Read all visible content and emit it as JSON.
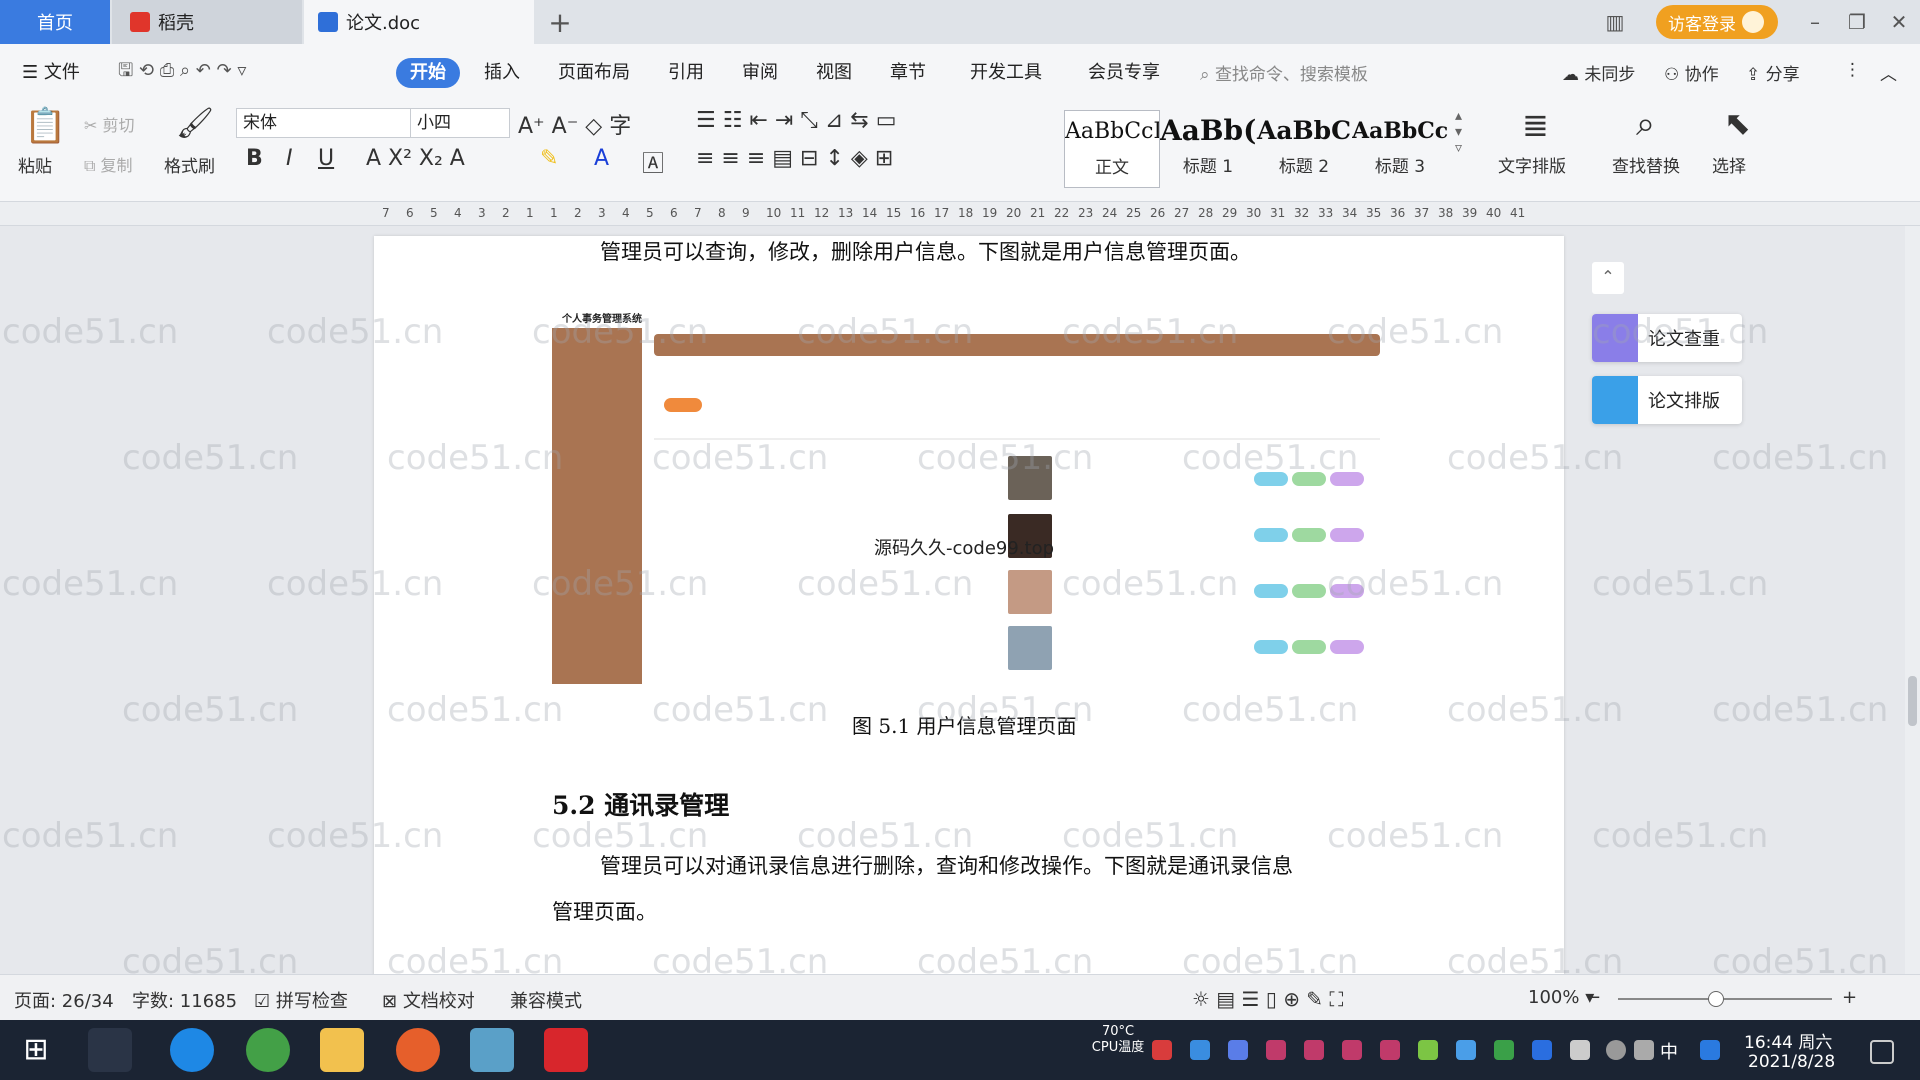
{
  "titlebar": {
    "tabs": [
      {
        "label": "首页"
      },
      {
        "label": "稻壳"
      },
      {
        "label": "论文.doc"
      }
    ],
    "visitor_login": "访客登录"
  },
  "menubar": {
    "file": "文件",
    "items": [
      "开始",
      "插入",
      "页面布局",
      "引用",
      "审阅",
      "视图",
      "章节",
      "开发工具",
      "会员专享"
    ],
    "search_placeholder": "查找命令、搜索模板",
    "right": [
      "未同步",
      "协作",
      "分享"
    ]
  },
  "ribbon": {
    "paste": "粘贴",
    "cut": "剪切",
    "copy": "复制",
    "format_painter": "格式刷",
    "font_name": "宋体",
    "font_size": "小四",
    "styles": [
      {
        "sample": "AaBbCcI",
        "name": "正文"
      },
      {
        "sample": "AaBb(",
        "name": "标题 1"
      },
      {
        "sample": "AaBbC",
        "name": "标题 2"
      },
      {
        "sample": "AaBbCcl",
        "name": "标题 3"
      }
    ],
    "text_layout": "文字排版",
    "find_replace": "查找替换",
    "select": "选择"
  },
  "ruler": {
    "labels": [
      "7",
      "6",
      "5",
      "4",
      "3",
      "2",
      "1",
      "1",
      "2",
      "3",
      "4",
      "5",
      "6",
      "7",
      "8",
      "9",
      "10",
      "11",
      "12",
      "13",
      "14",
      "15",
      "16",
      "17",
      "18",
      "19",
      "20",
      "21",
      "22",
      "23",
      "24",
      "25",
      "26",
      "27",
      "28",
      "29",
      "30",
      "31",
      "32",
      "33",
      "34",
      "35",
      "36",
      "37",
      "38",
      "39",
      "40",
      "41"
    ]
  },
  "document": {
    "para1": "管理员可以查询，修改，删除用户信息。下图就是用户信息管理页面。",
    "figure_app_title": "个人事务管理系统",
    "figure_overlay": "源码久久-code99.top",
    "caption": "图 5.1  用户信息管理页面",
    "heading": "5.2  通讯录管理",
    "para2_line1": "管理员可以对通讯录信息进行删除，查询和修改操作。下图就是通讯录信息",
    "para2_line2": "管理页面。"
  },
  "watermark": "code51.cn",
  "float_panel": {
    "check": "论文查重",
    "layout": "论文排版"
  },
  "statusbar": {
    "page": "页面: 26/34",
    "word_count": "字数: 11685",
    "spell_check": "拼写检查",
    "doc_proof": "文档校对",
    "compat_mode": "兼容模式",
    "zoom": "100%"
  },
  "taskbar": {
    "cpu_temp": "70°C",
    "cpu_label": "CPU温度",
    "ime": "中",
    "time": "16:44 周六",
    "date": "2021/8/28"
  },
  "colors": {
    "accent": "#3a7be0",
    "visitor": "#f0a020",
    "figure_brown": "#a97452",
    "taskbar": "#1b2433"
  }
}
